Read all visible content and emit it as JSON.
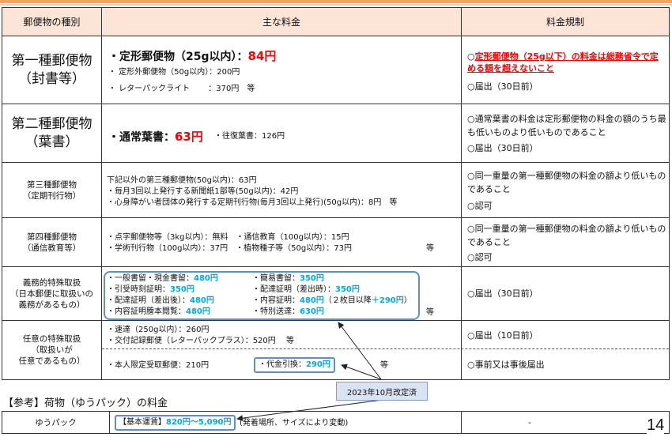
{
  "header": {
    "type": "郵便物の種別",
    "fees": "主な料金",
    "regulation": "料金規制"
  },
  "rows": [
    {
      "label": [
        "第一種郵便物",
        "（封書等）"
      ],
      "fees": [
        {
          "text": "・定形郵便物（25g以内）：",
          "price": "84円"
        },
        {
          "text": "・ 定形外郵便物（50g以内）：200円"
        },
        {
          "text": "・ レターパックライト　　 ：370円　等"
        }
      ],
      "reg": [
        "○",
        "定形郵便物（25g以下）の料金は総務省令で定める額を超えないこと",
        "○届出（30日前）"
      ]
    },
    {
      "label": [
        "第二種郵便物",
        "（葉書）"
      ],
      "fees": [
        {
          "text": "・通常葉書：",
          "price": "63円"
        },
        {
          "text": "・往復葉書：126円"
        }
      ],
      "reg": [
        "○通常葉書の料金は定形郵便物の料金の額のうち最も低いものより低いものであること",
        "○届出（30日前）"
      ]
    },
    {
      "label": [
        "第三種郵便物",
        "（定期刊行物）"
      ],
      "fees": [
        "下記以外の第三種郵便物(50g以内)：63円",
        "・毎月3回以上発行する新聞紙1部等(50g以内)：42円",
        "・心身障がい者団体の発行する定期刊行物(毎月3回以上発行)(50g以内)：8円　等"
      ],
      "reg": [
        "○同一重量の第一種郵便物の料金の額より低いものであること",
        "○認可"
      ]
    },
    {
      "label": [
        "第四種郵便物",
        "（通信教育等）"
      ],
      "fees": [
        "・点字郵便物等（3kg以内）：無料　・通信教育（100g以内）：15円",
        "・学術刊行物（100g以内）：37円　・植物種子等（50g以内）：73円",
        "等"
      ],
      "reg": [
        "○同一重量の第一種郵便物の料金の額より低いものであること",
        "○認可"
      ]
    },
    {
      "label": [
        "義務的特殊取扱",
        "（日本郵便に取扱いの",
        "義務があるもの）"
      ],
      "fees": [
        {
          "text": "・一般書留・現金書留：",
          "price": "480円"
        },
        {
          "text": "・簡易書留：",
          "price": "350円"
        },
        {
          "text": "・引受時刻証明：",
          "price": "350円"
        },
        {
          "text": "・配達証明（差出時）：",
          "price": "350円"
        },
        {
          "text": "・配達証明（差出後）：",
          "price": "480円"
        },
        {
          "text": "・内容証明：",
          "price": "480円",
          "extra": "（２枚目以降",
          "extra_price": "＋290円",
          "extra_end": "）"
        },
        {
          "text": "・内容証明謄本閲覧：",
          "price": "480円"
        },
        {
          "text": "・特別送達：",
          "price": "630円"
        }
      ],
      "etc": "等",
      "reg": [
        "○届出（30日前）"
      ]
    },
    {
      "label": [
        "任意の特殊取扱",
        "（取扱いが",
        "任意であるもの）"
      ],
      "fees_top": [
        "・速達（250g以内）：260円",
        "・交付記録郵便（レターパックプラス）：520円　 等"
      ],
      "fees_bottom": {
        "text": "・本人限定受取郵便：210円",
        "boxed": "・代金引換：",
        "boxed_price": "290円",
        "etc": "等"
      },
      "reg_top": "○届出（10日前）",
      "reg_bottom": "○事前又は事後届出"
    }
  ],
  "callout": "2023年10月改定済",
  "reference": {
    "title": "【参考】荷物（ゆうパック）の料金",
    "label": "ゆうパック",
    "boxed": "【基本運賃】",
    "price": "820円～5,090円",
    "note": "(発着場所、サイズにより変動)",
    "reg": "-"
  },
  "page_number": "14",
  "colors": {
    "red": "#ff0000",
    "blue": "#00a8e8",
    "header_bg": "#fce4d6",
    "box": "#5b8fd0"
  }
}
